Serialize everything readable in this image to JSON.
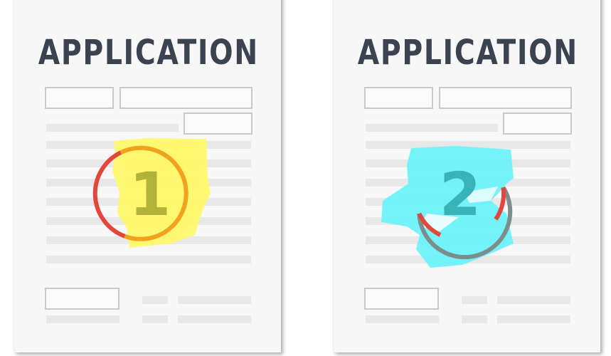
{
  "documents": [
    {
      "title": "APPLICATION",
      "badge": "1"
    },
    {
      "title": "APPLICATION",
      "badge": "2"
    }
  ],
  "colors": {
    "title": "#3b4350",
    "page": "#f7f7f7",
    "field_border": "#c9c9c9",
    "text_line": "#e8e8e8",
    "highlight_yellow": "#fdf96a",
    "highlight_cyan": "#6af2fa",
    "ring_orange": "#f0a21e",
    "ring_red": "#e3463a",
    "ring_grey": "#7c8e8c",
    "digit_olive": "#b2b139",
    "digit_teal": "#3ab3b8"
  },
  "icons": [
    "yellow-highlight-scribble",
    "cyan-highlight-scribble",
    "number-one-badge",
    "number-two-badge"
  ]
}
